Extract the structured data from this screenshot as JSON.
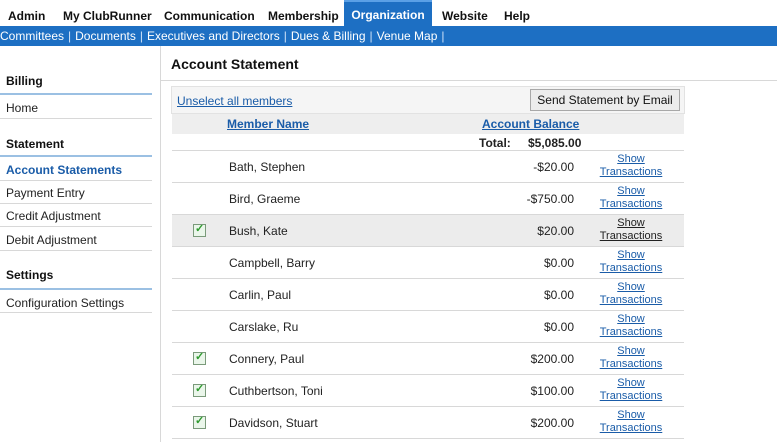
{
  "nav": {
    "tabs": [
      "Admin",
      "My ClubRunner",
      "Communication",
      "Membership",
      "Organization",
      "Website",
      "Help"
    ],
    "active_tab": "Organization"
  },
  "subnav": {
    "items": [
      "Committees",
      "Documents",
      "Executives and Directors",
      "Dues & Billing",
      "Venue Map"
    ]
  },
  "sidebar": {
    "billing_heading": "Billing",
    "home": "Home",
    "statement_heading": "Statement",
    "account_statements": "Account Statements",
    "payment_entry": "Payment Entry",
    "credit_adjustment": "Credit Adjustment",
    "debit_adjustment": "Debit Adjustment",
    "settings_heading": "Settings",
    "configuration_settings": "Configuration Settings"
  },
  "main": {
    "title": "Account Statement",
    "unselect_link": "Unselect all members",
    "send_button": "Send Statement by Email",
    "col_member": "Member Name",
    "col_balance": "Account Balance",
    "total_label": "Total:",
    "total_value": "$5,085.00",
    "show_line1": "Show",
    "show_line2": "Transactions",
    "rows": [
      {
        "name": "Bath, Stephen",
        "balance": "-$20.00",
        "checked": false
      },
      {
        "name": "Bird, Graeme",
        "balance": "-$750.00",
        "checked": false
      },
      {
        "name": "Bush, Kate",
        "balance": "$20.00",
        "checked": true
      },
      {
        "name": "Campbell, Barry",
        "balance": "$0.00",
        "checked": false
      },
      {
        "name": "Carlin, Paul",
        "balance": "$0.00",
        "checked": false
      },
      {
        "name": "Carslake, Ru",
        "balance": "$0.00",
        "checked": false
      },
      {
        "name": "Connery, Paul",
        "balance": "$200.00",
        "checked": true
      },
      {
        "name": "Cuthbertson, Toni",
        "balance": "$100.00",
        "checked": true
      },
      {
        "name": "Davidson, Stuart",
        "balance": "$200.00",
        "checked": true
      }
    ]
  }
}
